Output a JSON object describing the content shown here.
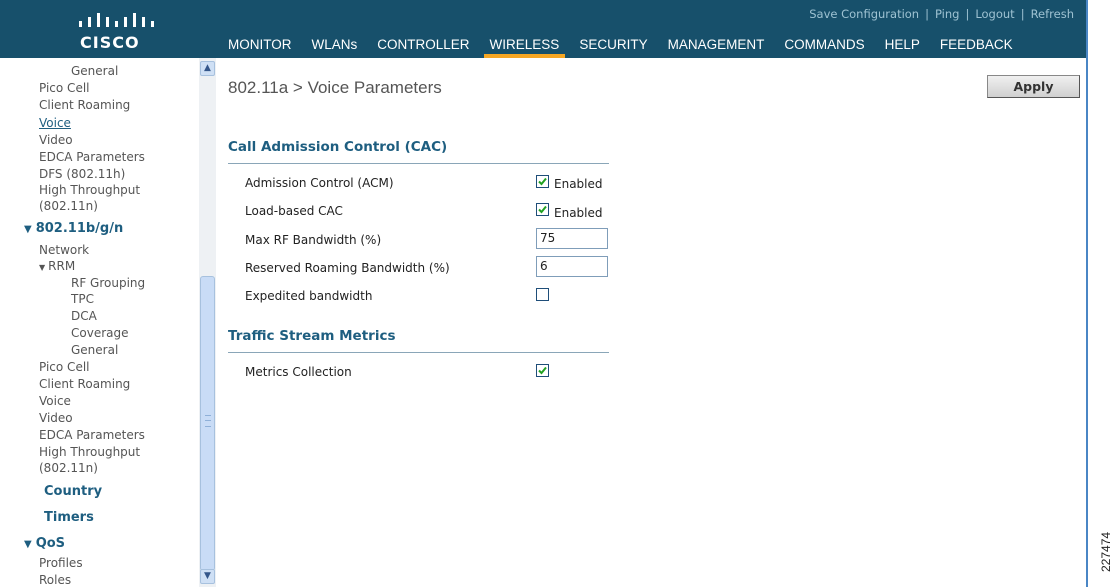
{
  "header": {
    "logo_text": "CISCO",
    "utility_links": [
      "Save Configuration",
      "Ping",
      "Logout",
      "Refresh"
    ],
    "menu": [
      {
        "label": "MONITOR",
        "active": false
      },
      {
        "label": "WLANs",
        "active": false
      },
      {
        "label": "CONTROLLER",
        "active": false
      },
      {
        "label": "WIRELESS",
        "active": true
      },
      {
        "label": "SECURITY",
        "active": false
      },
      {
        "label": "MANAGEMENT",
        "active": false
      },
      {
        "label": "COMMANDS",
        "active": false
      },
      {
        "label": "HELP",
        "active": false
      },
      {
        "label": "FEEDBACK",
        "active": false
      }
    ]
  },
  "sidebar": {
    "items": [
      {
        "label": "General"
      },
      {
        "label": "Pico Cell"
      },
      {
        "label": "Client Roaming"
      },
      {
        "label": "Voice"
      },
      {
        "label": "Video"
      },
      {
        "label": "EDCA Parameters"
      },
      {
        "label": "DFS (802.11h)"
      },
      {
        "label": "High Throughput"
      },
      {
        "label": "(802.11n)"
      },
      {
        "label": "802.11b/g/n"
      },
      {
        "label": "Network"
      },
      {
        "label": "RRM"
      },
      {
        "label": "RF Grouping"
      },
      {
        "label": "TPC"
      },
      {
        "label": "DCA"
      },
      {
        "label": "Coverage"
      },
      {
        "label": "General"
      },
      {
        "label": "Pico Cell"
      },
      {
        "label": "Client Roaming"
      },
      {
        "label": "Voice"
      },
      {
        "label": "Video"
      },
      {
        "label": "EDCA Parameters"
      },
      {
        "label": "High Throughput"
      },
      {
        "label": "(802.11n)"
      },
      {
        "label": "Country"
      },
      {
        "label": "Timers"
      },
      {
        "label": "QoS"
      },
      {
        "label": "Profiles"
      },
      {
        "label": "Roles"
      }
    ]
  },
  "main": {
    "title": "802.11a > Voice Parameters",
    "apply_label": "Apply",
    "cac": {
      "heading": "Call Admission Control (CAC)",
      "admission_control": {
        "label": "Admission Control (ACM)",
        "checked": true,
        "text": "Enabled"
      },
      "load_based": {
        "label": "Load-based CAC",
        "checked": true,
        "text": "Enabled"
      },
      "max_rf": {
        "label": "Max RF Bandwidth (%)",
        "value": "75"
      },
      "reserved_roaming": {
        "label": "Reserved Roaming Bandwidth (%)",
        "value": "6"
      },
      "expedited": {
        "label": "Expedited bandwidth",
        "checked": false
      }
    },
    "tsm": {
      "heading": "Traffic Stream Metrics",
      "metrics_collection": {
        "label": "Metrics Collection",
        "checked": true
      }
    }
  },
  "figure_id": "227474",
  "colors": {
    "header_bg": "#17506b",
    "active_tab": "#f5a623",
    "section_heading": "#1e5e80",
    "frame_border": "#4a86c5"
  }
}
